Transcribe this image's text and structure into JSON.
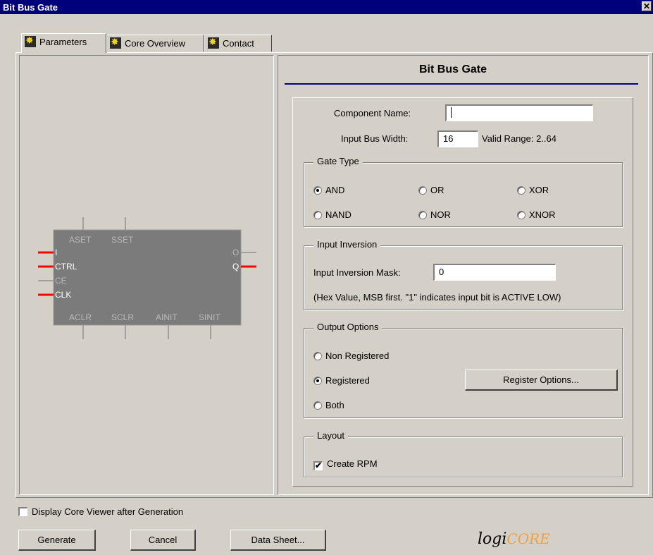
{
  "window": {
    "title": "Bit Bus Gate",
    "close_glyph": "✕"
  },
  "tabs": [
    {
      "label": "Parameters",
      "icon": "xilinx-core-icon",
      "active": true
    },
    {
      "label": "Core Overview",
      "icon": "xilinx-core-icon",
      "active": false
    },
    {
      "label": "Contact",
      "icon": "xilinx-core-icon",
      "active": false
    }
  ],
  "symbol": {
    "top_pins": [
      "ASET",
      "SSET"
    ],
    "left_pins": [
      "I",
      "CTRL",
      "CE",
      "CLK"
    ],
    "right_pins": [
      "O",
      "Q"
    ],
    "bottom_pins": [
      "ACLR",
      "SCLR",
      "AINIT",
      "SINIT"
    ],
    "colors": {
      "body": "#7b7b7b",
      "active_pin": "#ff0000",
      "inactive_pin": "#a0a0a0",
      "label_active": "#ffffff",
      "label_inactive": "#b8b8b8"
    }
  },
  "form": {
    "heading": "Bit Bus Gate",
    "component_name_label": "Component Name:",
    "component_name_value": "",
    "input_bus_width_label": "Input Bus Width:",
    "input_bus_width_value": "16",
    "valid_range": "Valid Range: 2..64",
    "gate_type": {
      "title": "Gate Type",
      "options": [
        {
          "label": "AND",
          "selected": true
        },
        {
          "label": "OR",
          "selected": false
        },
        {
          "label": "XOR",
          "selected": false
        },
        {
          "label": "NAND",
          "selected": false
        },
        {
          "label": "NOR",
          "selected": false
        },
        {
          "label": "XNOR",
          "selected": false
        }
      ]
    },
    "input_inversion": {
      "title": "Input Inversion",
      "mask_label": "Input Inversion Mask:",
      "mask_value": "0",
      "hint": "(Hex Value, MSB first. \"1\" indicates input bit is ACTIVE LOW)"
    },
    "output_options": {
      "title": "Output Options",
      "options": [
        {
          "label": "Non Registered",
          "selected": false
        },
        {
          "label": "Registered",
          "selected": true
        },
        {
          "label": "Both",
          "selected": false
        }
      ],
      "register_options_button": "Register Options..."
    },
    "layout": {
      "title": "Layout",
      "create_rpm_label": "Create RPM",
      "create_rpm_checked": true
    }
  },
  "footer": {
    "display_viewer_label": "Display Core Viewer after Generation",
    "display_viewer_checked": false,
    "buttons": {
      "generate": "Generate",
      "cancel": "Cancel",
      "data_sheet": "Data Sheet..."
    },
    "logo": {
      "prefix": "logi",
      "suffix": "CORE"
    }
  },
  "colors": {
    "title_bar": "#00007b",
    "heading_rule": "#00007b",
    "logo_orange": "#f0a040",
    "logo_text": "#000000"
  }
}
